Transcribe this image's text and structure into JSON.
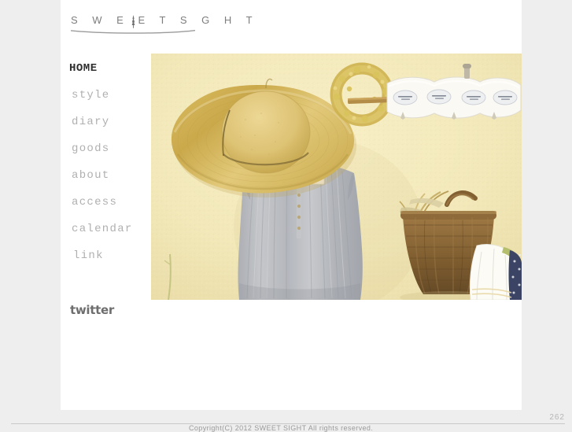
{
  "site": {
    "logo_text": "S W E E T  S  G H T",
    "logo_icon": "tree-icon"
  },
  "nav": {
    "items": [
      {
        "label": "HOME",
        "active": true
      },
      {
        "label": "style",
        "active": false
      },
      {
        "label": "diary",
        "active": false
      },
      {
        "label": "goods",
        "active": false
      },
      {
        "label": "about",
        "active": false
      },
      {
        "label": "access",
        "active": false
      },
      {
        "label": "calendar",
        "active": false
      },
      {
        "label": "link",
        "active": false
      }
    ]
  },
  "social": {
    "twitter_label": "twitter"
  },
  "hero": {
    "alt": "Straw sun hat and gray dress hanging on a cream textured wall, with a dried wreath, a white wall hook rack and a wicker basket",
    "wall_color": "#f2e9bf",
    "hat_color": "#e0c267",
    "dress_color": "#b9bcc4",
    "basket_color": "#8a6434",
    "wreath_color": "#d8c05a"
  },
  "footer": {
    "page_counter": "262",
    "copyright": "Copyright(C) 2012 SWEET SIGHT All rights reserved."
  },
  "colors": {
    "page_background": "#eeeeee",
    "content_background": "#ffffff",
    "nav_inactive": "#b0b0b0",
    "nav_active": "#2e2e2e",
    "divider": "#c9c9c9"
  }
}
